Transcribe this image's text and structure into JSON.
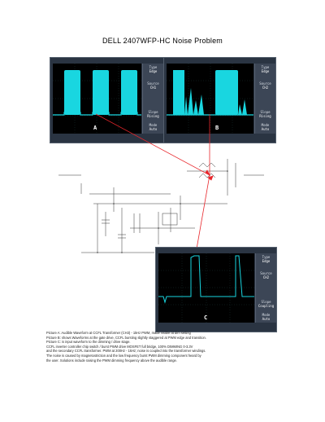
{
  "title": "DELL 2407WFP-HC Noise Problem",
  "scope_a": {
    "label": "A",
    "menu": [
      {
        "label": "Type",
        "value": "Edge"
      },
      {
        "label": "Source",
        "value": "CH1"
      },
      {
        "label": "Slope",
        "value": "Rising"
      },
      {
        "label": "Mode",
        "value": "Auto"
      }
    ]
  },
  "scope_b": {
    "label": "B",
    "menu": [
      {
        "label": "Type",
        "value": "Edge"
      },
      {
        "label": "Source",
        "value": "CH2"
      },
      {
        "label": "Slope",
        "value": "Rising"
      },
      {
        "label": "Mode",
        "value": "Auto"
      }
    ]
  },
  "scope_c": {
    "label": "C",
    "menu": [
      {
        "label": "Type",
        "value": "Edge"
      },
      {
        "label": "Source",
        "value": "CH2"
      },
      {
        "label": "Slope",
        "value": "Coupling"
      },
      {
        "label": "Mode",
        "value": "Auto"
      }
    ]
  },
  "caption": [
    "Picture A: Audible Waveform at CCFL Transformer (CH3) - 1kHz PWM, made visible at dim setting",
    "Picture B: shows Waveforms at the gate drive, CCFL bursting slightly staggered at PWM edge and transition.",
    "Picture C: is input waveform to the dimming / drive stage.",
    "CCFL inverter controller chip switch / burst PWM drive MOSFET full bridge, 100% DIMMING 0-3.3V",
    "and the secondary CCFL transformer. PWM at 200Hz - 1kHz; noise is coupled into the transformer windings.",
    "The noise is caused by magnetostriction and the low frequency burst PWM dimming component heard by",
    "the user. Solutions include raising the PWM dimming frequency above the audible range."
  ]
}
